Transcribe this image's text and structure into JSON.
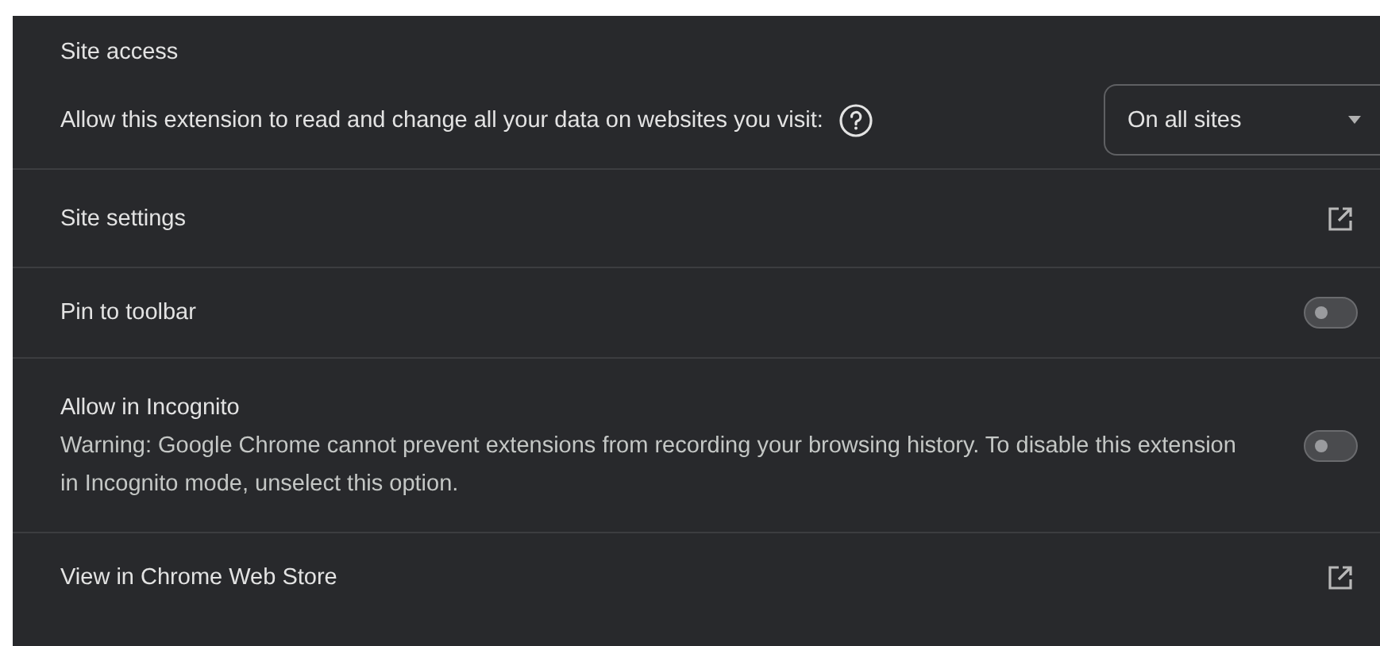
{
  "site_access": {
    "title": "Site access",
    "description": "Allow this extension to read and change all your data on websites you visit:",
    "dropdown": {
      "value": "On all sites"
    }
  },
  "rows": [
    {
      "kind": "link",
      "label": "Site settings"
    },
    {
      "kind": "toggle",
      "label": "Pin to toolbar",
      "on": false
    },
    {
      "kind": "toggle",
      "label": "Allow in Incognito",
      "description": "Warning: Google Chrome cannot prevent extensions from recording your browsing history. To disable this extension in Incognito mode, unselect this option.",
      "on": false
    },
    {
      "kind": "link",
      "label": "View in Chrome Web Store"
    }
  ]
}
